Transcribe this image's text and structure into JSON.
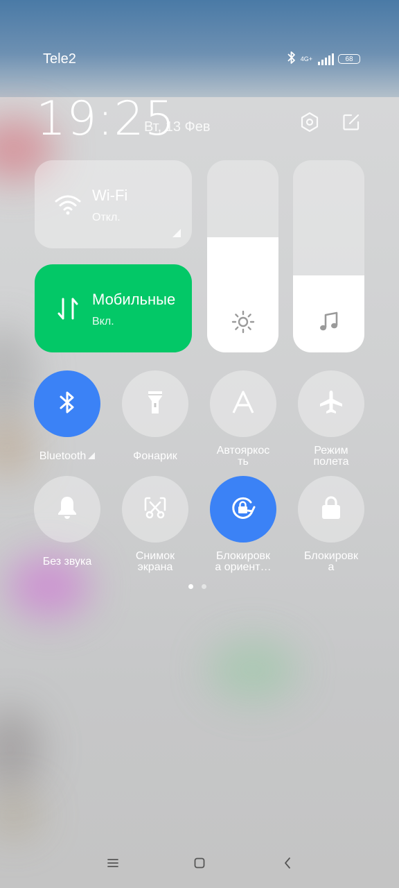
{
  "status_bar": {
    "carrier": "Tele2",
    "network": "4G+",
    "battery": "68",
    "icons": [
      "bluetooth-icon",
      "signal-icon",
      "battery-icon"
    ]
  },
  "header": {
    "time": "19:25",
    "date": "Вт, 13 Фев",
    "icons": [
      "settings-icon",
      "edit-icon"
    ]
  },
  "tiles": {
    "wifi": {
      "title": "Wi-Fi",
      "status": "Откл.",
      "icon": "wifi-icon"
    },
    "mobile": {
      "title": "Мобильные",
      "status": "Вкл.",
      "icon": "mobile-data-icon",
      "color": "#03C867"
    }
  },
  "sliders": {
    "brightness": {
      "icon": "brightness-icon",
      "level": 0.6
    },
    "volume": {
      "icon": "music-note-icon",
      "level": 0.4
    }
  },
  "toggles": [
    {
      "label": "Bluetooth",
      "active": true,
      "icon": "bluetooth-icon"
    },
    {
      "label": "Фонарик",
      "active": false,
      "icon": "flashlight-icon"
    },
    {
      "label_1": "Автояркос",
      "label_2": "ть",
      "active": false,
      "icon": "auto-brightness-icon"
    },
    {
      "label_1": "Режим",
      "label_2": "полета",
      "active": false,
      "icon": "airplane-icon"
    },
    {
      "label": "Без звука",
      "active": false,
      "icon": "bell-icon"
    },
    {
      "label_1": "Снимок",
      "label_2": "экрана",
      "active": false,
      "icon": "screenshot-icon"
    },
    {
      "label_1": "Блокировк",
      "label_2": "а ориент…",
      "active": true,
      "icon": "rotation-lock-icon"
    },
    {
      "label_1": "Блокировк",
      "label_2": "а",
      "active": false,
      "icon": "lock-icon"
    }
  ],
  "colors": {
    "accent_blue": "#3B82F6",
    "mobile_green": "#03C867"
  },
  "pagination": {
    "pages": 2,
    "current": 1
  },
  "navbar": {
    "icons": [
      "menu-icon",
      "home-icon",
      "back-icon"
    ]
  }
}
